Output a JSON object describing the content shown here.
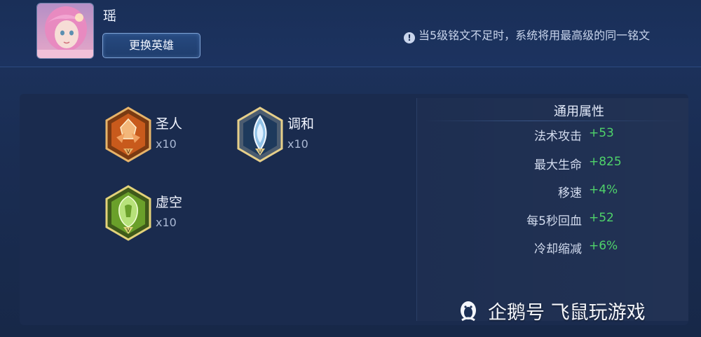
{
  "hero": {
    "name": "瑶",
    "change_button": "更换英雄"
  },
  "notice": {
    "text": "当5级铭文不足时，系统将用最高级的同一铭文"
  },
  "runes": [
    {
      "name": "圣人",
      "count": "x10",
      "icon": "sage-rune-icon",
      "color": "#d96a1f"
    },
    {
      "name": "调和",
      "count": "x10",
      "icon": "harmony-rune-icon",
      "color": "#8fb8d8"
    },
    {
      "name": "虚空",
      "count": "x10",
      "icon": "void-rune-icon",
      "color": "#8cc63f"
    }
  ],
  "attributes": {
    "title": "通用属性",
    "items": [
      {
        "label": "法术攻击",
        "value": "+53"
      },
      {
        "label": "最大生命",
        "value": "+825"
      },
      {
        "label": "移速",
        "value": "+4%"
      },
      {
        "label": "每5秒回血",
        "value": "+52"
      },
      {
        "label": "冷却缩减",
        "value": "+6%"
      }
    ]
  },
  "watermark": {
    "text": "企鹅号 飞鼠玩游戏"
  },
  "colors": {
    "background": "#1b2f55",
    "positive": "#4fd36a",
    "button_border": "#7fa3d6"
  }
}
